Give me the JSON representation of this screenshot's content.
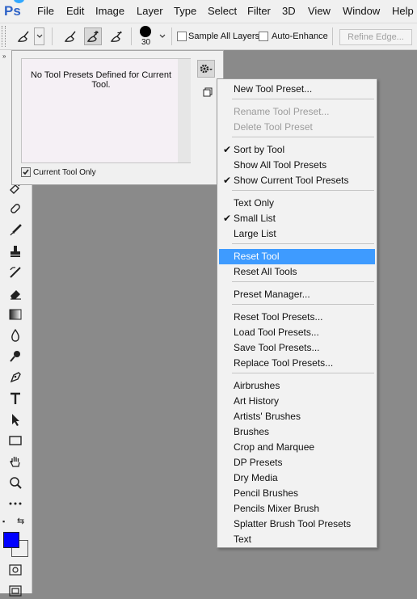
{
  "app": {
    "logo": "Ps"
  },
  "menubar": {
    "items": [
      "File",
      "Edit",
      "Image",
      "Layer",
      "Type",
      "Select",
      "Filter",
      "3D",
      "View",
      "Window",
      "Help"
    ]
  },
  "options_bar": {
    "brush_size": "30",
    "sample_all_layers": "Sample All Layers",
    "auto_enhance": "Auto-Enhance",
    "refine_edge": "Refine Edge..."
  },
  "preset_panel": {
    "empty_message": "No Tool Presets Defined for Current Tool.",
    "current_tool_only_label": "Current Tool Only",
    "current_tool_only_checked": true
  },
  "context_menu": {
    "items": [
      {
        "label": "New Tool Preset...",
        "disabled": false,
        "checked": false,
        "highlight": false
      },
      {
        "label": "Rename Tool Preset...",
        "disabled": true,
        "checked": false,
        "highlight": false
      },
      {
        "label": "Delete Tool Preset",
        "disabled": true,
        "checked": false,
        "highlight": false
      },
      {
        "label": "Sort by Tool",
        "disabled": false,
        "checked": true,
        "highlight": false
      },
      {
        "label": "Show All Tool Presets",
        "disabled": false,
        "checked": false,
        "highlight": false
      },
      {
        "label": "Show Current Tool Presets",
        "disabled": false,
        "checked": true,
        "highlight": false
      },
      {
        "label": "Text Only",
        "disabled": false,
        "checked": false,
        "highlight": false
      },
      {
        "label": "Small List",
        "disabled": false,
        "checked": true,
        "highlight": false
      },
      {
        "label": "Large List",
        "disabled": false,
        "checked": false,
        "highlight": false
      },
      {
        "label": "Reset Tool",
        "disabled": false,
        "checked": false,
        "highlight": true
      },
      {
        "label": "Reset All Tools",
        "disabled": false,
        "checked": false,
        "highlight": false
      },
      {
        "label": "Preset Manager...",
        "disabled": false,
        "checked": false,
        "highlight": false
      },
      {
        "label": "Reset Tool Presets...",
        "disabled": false,
        "checked": false,
        "highlight": false
      },
      {
        "label": "Load Tool Presets...",
        "disabled": false,
        "checked": false,
        "highlight": false
      },
      {
        "label": "Save Tool Presets...",
        "disabled": false,
        "checked": false,
        "highlight": false
      },
      {
        "label": "Replace Tool Presets...",
        "disabled": false,
        "checked": false,
        "highlight": false
      },
      {
        "label": "Airbrushes",
        "disabled": false,
        "checked": false,
        "highlight": false
      },
      {
        "label": "Art History",
        "disabled": false,
        "checked": false,
        "highlight": false
      },
      {
        "label": "Artists' Brushes",
        "disabled": false,
        "checked": false,
        "highlight": false
      },
      {
        "label": "Brushes",
        "disabled": false,
        "checked": false,
        "highlight": false
      },
      {
        "label": "Crop and Marquee",
        "disabled": false,
        "checked": false,
        "highlight": false
      },
      {
        "label": "DP Presets",
        "disabled": false,
        "checked": false,
        "highlight": false
      },
      {
        "label": "Dry Media",
        "disabled": false,
        "checked": false,
        "highlight": false
      },
      {
        "label": "Pencil Brushes",
        "disabled": false,
        "checked": false,
        "highlight": false
      },
      {
        "label": "Pencils Mixer Brush",
        "disabled": false,
        "checked": false,
        "highlight": false
      },
      {
        "label": "Splatter Brush Tool Presets",
        "disabled": false,
        "checked": false,
        "highlight": false
      },
      {
        "label": "Text",
        "disabled": false,
        "checked": false,
        "highlight": false
      }
    ]
  },
  "colors": {
    "foreground": "#0000ff",
    "background": "#ffffff",
    "highlight": "#3e9bff"
  },
  "toolbar_icons": [
    "brush-icon",
    "healing-icon",
    "brush-tool-icon",
    "stamp-icon",
    "history-brush-icon",
    "eraser-icon",
    "gradient-icon",
    "blur-icon",
    "dodge-icon",
    "pen-icon",
    "type-icon",
    "path-select-icon",
    "rectangle-icon",
    "hand-icon",
    "zoom-icon",
    "more-icon"
  ]
}
